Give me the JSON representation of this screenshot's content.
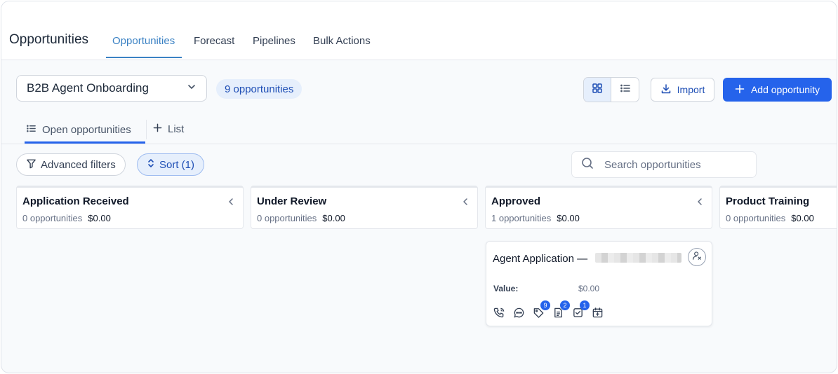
{
  "header": {
    "title": "Opportunities",
    "tabs": [
      {
        "label": "Opportunities"
      },
      {
        "label": "Forecast"
      },
      {
        "label": "Pipelines"
      },
      {
        "label": "Bulk Actions"
      }
    ]
  },
  "toolbar": {
    "pipeline": "B2B Agent Onboarding",
    "count": "9 opportunities",
    "import_label": "Import",
    "add_label": "Add opportunity"
  },
  "subtabs": {
    "open": "Open opportunities",
    "list": "List"
  },
  "filters": {
    "advanced": "Advanced filters",
    "sort": "Sort (1)",
    "search_placeholder": "Search opportunities"
  },
  "columns": [
    {
      "title": "Application Received",
      "count": "0 opportunities",
      "value": "$0.00"
    },
    {
      "title": "Under Review",
      "count": "0 opportunities",
      "value": "$0.00"
    },
    {
      "title": "Approved",
      "count": "1 opportunities",
      "value": "$0.00"
    },
    {
      "title": "Product Training",
      "count": "0 opportunities",
      "value": "$0.00"
    }
  ],
  "card": {
    "title": "Agent Application —",
    "value_label": "Value:",
    "value": "$0.00",
    "icons": [
      {
        "name": "phone-icon",
        "badge": ""
      },
      {
        "name": "chat-icon",
        "badge": ""
      },
      {
        "name": "tag-icon",
        "badge": "9"
      },
      {
        "name": "notes-icon",
        "badge": "2"
      },
      {
        "name": "tasks-icon",
        "badge": "1"
      },
      {
        "name": "calendar-icon",
        "badge": ""
      }
    ]
  }
}
